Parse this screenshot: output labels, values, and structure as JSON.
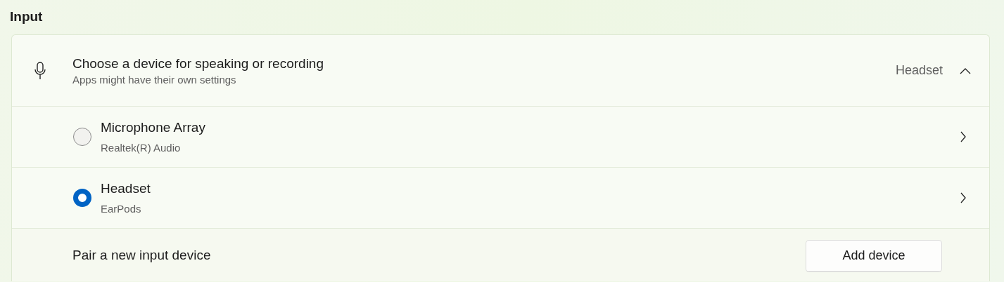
{
  "section_title": "Input",
  "device_chooser": {
    "title": "Choose a device for speaking or recording",
    "subtitle": "Apps might have their own settings",
    "current": "Headset",
    "expanded": true
  },
  "devices": [
    {
      "name": "Microphone Array",
      "detail": "Realtek(R) Audio",
      "selected": false
    },
    {
      "name": "Headset",
      "detail": "EarPods",
      "selected": true
    }
  ],
  "pair": {
    "label": "Pair a new input device",
    "button": "Add device"
  }
}
